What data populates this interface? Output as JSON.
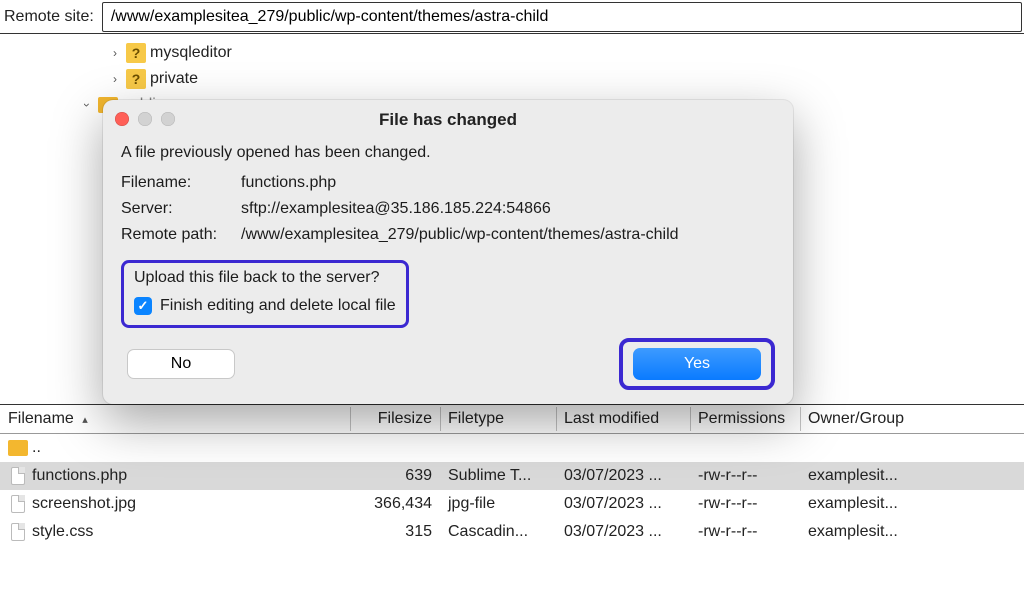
{
  "remoteBar": {
    "label": "Remote site:",
    "path": "/www/examplesitea_279/public/wp-content/themes/astra-child"
  },
  "tree": {
    "items": [
      {
        "icon": "qmark",
        "label": "mysqleditor",
        "expandable": true
      },
      {
        "icon": "qmark",
        "label": "private",
        "expandable": true
      },
      {
        "icon": "folder",
        "label": "public",
        "expandable": true,
        "expanded": true
      }
    ]
  },
  "dialog": {
    "title": "File has changed",
    "message": "A file previously opened has been changed.",
    "filenameLabel": "Filename:",
    "filename": "functions.php",
    "serverLabel": "Server:",
    "server": "sftp://examplesitea@35.186.185.224:54866",
    "remotePathLabel": "Remote path:",
    "remotePath": "/www/examplesitea_279/public/wp-content/themes/astra-child",
    "uploadQuestion": "Upload this file back to the server?",
    "checkboxLabel": "Finish editing and delete local file",
    "checkboxChecked": true,
    "noLabel": "No",
    "yesLabel": "Yes"
  },
  "columns": {
    "filename": "Filename",
    "filesize": "Filesize",
    "filetype": "Filetype",
    "lastModified": "Last modified",
    "permissions": "Permissions",
    "ownerGroup": "Owner/Group"
  },
  "files": {
    "parent": "..",
    "rows": [
      {
        "name": "functions.php",
        "size": "639",
        "type": "Sublime T...",
        "modified": "03/07/2023 ...",
        "perm": "-rw-r--r--",
        "owner": "examplesit...",
        "selected": true
      },
      {
        "name": "screenshot.jpg",
        "size": "366,434",
        "type": "jpg-file",
        "modified": "03/07/2023 ...",
        "perm": "-rw-r--r--",
        "owner": "examplesit...",
        "selected": false
      },
      {
        "name": "style.css",
        "size": "315",
        "type": "Cascadin...",
        "modified": "03/07/2023 ...",
        "perm": "-rw-r--r--",
        "owner": "examplesit...",
        "selected": false
      }
    ]
  }
}
